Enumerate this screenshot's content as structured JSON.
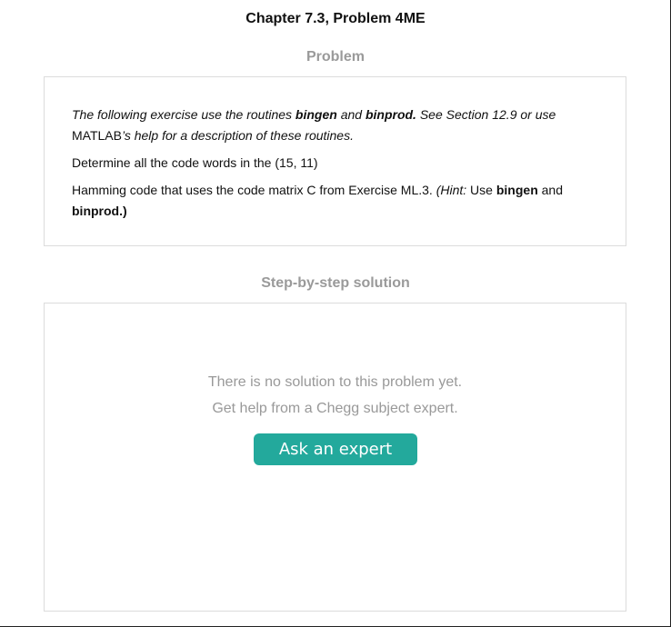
{
  "header": {
    "title": "Chapter 7.3, Problem 4ME"
  },
  "problem_section": {
    "label": "Problem",
    "paragraph1": {
      "t1": "The following exercise use the routines ",
      "b1": "bingen",
      "t2": " and ",
      "b2": "binprod.",
      "t3": " See Section 12.9 or use",
      "t4": "MATLAB",
      "t5": "’s help for a description of these routines."
    },
    "paragraph2": "Determine all the code words in the (15, 11)",
    "paragraph3": {
      "t1": "Hamming code that uses the code matrix C from Exercise ML.3. ",
      "hint": "(Hint:",
      "t2": " Use ",
      "b1": "bingen",
      "t3": " and",
      "b2": "binprod.)"
    }
  },
  "solution_section": {
    "label": "Step-by-step solution",
    "message_line1": "There is no solution to this problem yet.",
    "message_line2": "Get help from a Chegg subject expert.",
    "ask_button_label": "Ask an expert"
  },
  "colors": {
    "accent": "#23a99c",
    "label_gray": "#9a9a9a",
    "border": "#dcdcdc"
  }
}
